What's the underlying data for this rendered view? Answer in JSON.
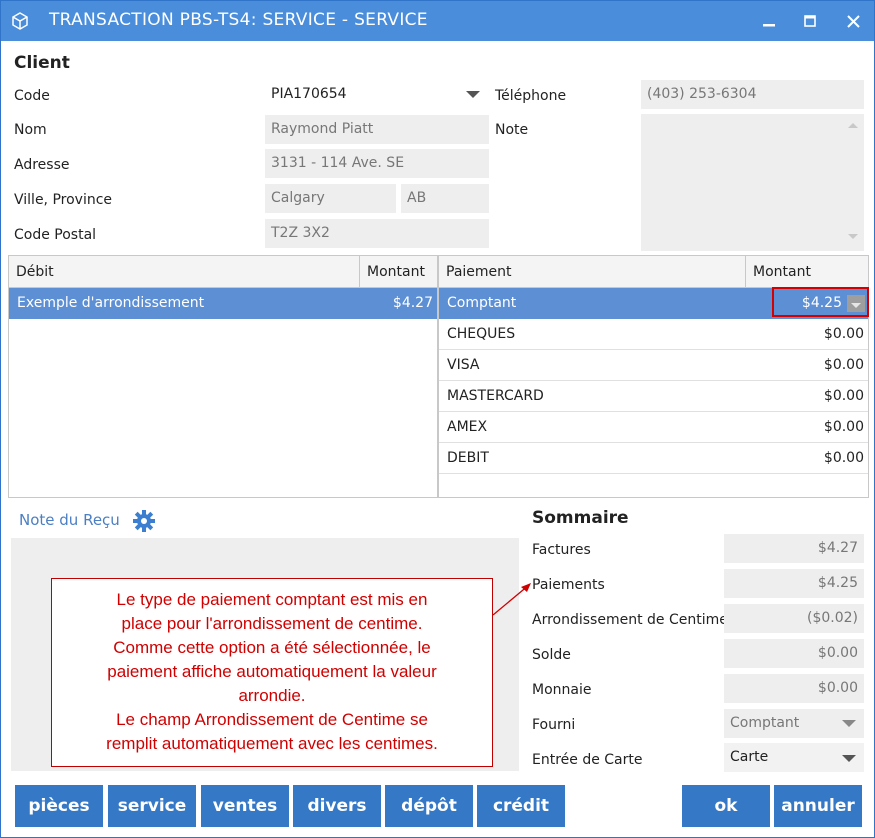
{
  "window": {
    "title": "TRANSACTION PBS-TS4: SERVICE - SERVICE",
    "minimize_glyph": "▁",
    "maximize_glyph": "☐",
    "close_glyph": "✕"
  },
  "client": {
    "heading": "Client",
    "code_label": "Code",
    "code_value": "PIA170654",
    "nom_label": "Nom",
    "nom_value": "Raymond Piatt",
    "adresse_label": "Adresse",
    "adresse_value": "3131 - 114 Ave. SE",
    "ville_label": "Ville, Province",
    "ville_value": "Calgary",
    "province_value": "AB",
    "postal_label": "Code Postal",
    "postal_value": "T2Z 3X2",
    "telephone_label": "Téléphone",
    "telephone_value": "(403) 253-6304",
    "note_label": "Note"
  },
  "debit_grid": {
    "col_debit": "Débit",
    "col_montant": "Montant",
    "rows": [
      {
        "label": "Exemple d'arrondissement",
        "amount": "$4.27"
      }
    ]
  },
  "payment_grid": {
    "col_paiement": "Paiement",
    "col_montant": "Montant",
    "rows": [
      {
        "label": "Comptant",
        "amount": "$4.25"
      },
      {
        "label": "CHEQUES",
        "amount": "$0.00"
      },
      {
        "label": "VISA",
        "amount": "$0.00"
      },
      {
        "label": "MASTERCARD",
        "amount": "$0.00"
      },
      {
        "label": "AMEX",
        "amount": "$0.00"
      },
      {
        "label": "DEBIT",
        "amount": "$0.00"
      }
    ]
  },
  "receipt_note": {
    "label": "Note du Reçu"
  },
  "summary": {
    "heading": "Sommaire",
    "factures_label": "Factures",
    "factures_value": "$4.27",
    "paiements_label": "Paiements",
    "paiements_value": "$4.25",
    "arrondissement_label": "Arrondissement de Centime",
    "arrondissement_value": "($0.02)",
    "solde_label": "Solde",
    "solde_value": "$0.00",
    "monnaie_label": "Monnaie",
    "monnaie_value": "$0.00",
    "fourni_label": "Fourni",
    "fourni_value": "Comptant",
    "entree_label": "Entrée de Carte",
    "entree_value": "Carte"
  },
  "callout": {
    "lines": [
      "Le type de paiement comptant est mis en",
      "place pour l'arrondissement de centime.",
      "Comme cette option a été sélectionnée, le",
      "paiement affiche automatiquement la valeur",
      "arrondie.",
      "Le champ Arrondissement de Centime se",
      "remplit automatiquement avec les centimes."
    ]
  },
  "buttons": {
    "pieces": "pièces",
    "service": "service",
    "ventes": "ventes",
    "divers": "divers",
    "depot": "dépôt",
    "credit": "crédit",
    "ok": "ok",
    "annuler": "annuler"
  },
  "colors": {
    "titlebar": "#4a8ddb",
    "button": "#3478c6",
    "selected_row": "#5d8fd4",
    "callout_red": "#d00000"
  }
}
